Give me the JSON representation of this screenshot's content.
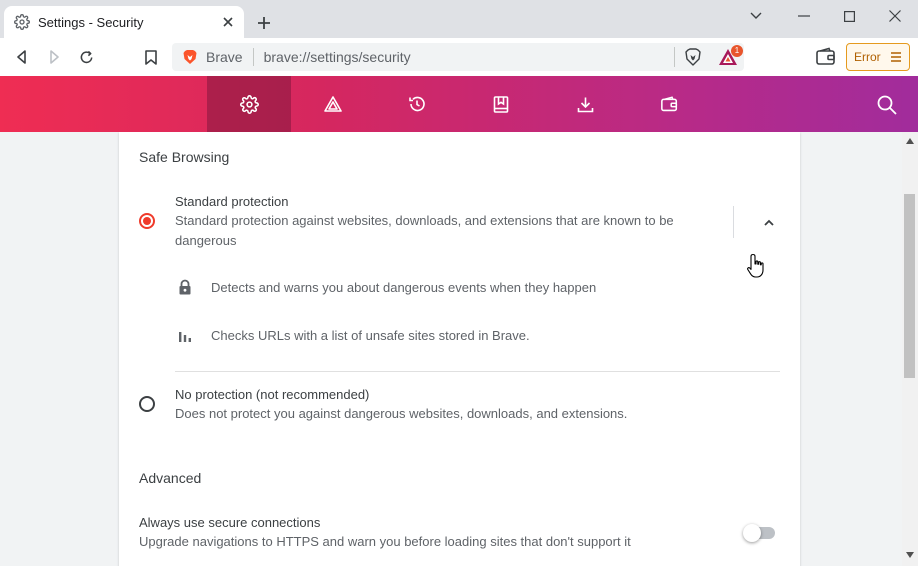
{
  "tab": {
    "title": "Settings - Security",
    "favicon": "gear-icon"
  },
  "window_controls": [
    "chevron-down-icon",
    "minimize-icon",
    "maximize-icon",
    "close-icon"
  ],
  "omnibox": {
    "site_chip": "Brave",
    "url": "brave://settings/security"
  },
  "rewards": {
    "badge": "1"
  },
  "error_button": {
    "label": "Error"
  },
  "nav": {
    "items": [
      "gear-icon",
      "brave-rewards-icon",
      "history-icon",
      "bookmarks-icon",
      "downloads-icon",
      "wallet-icon"
    ],
    "active_index": 0
  },
  "safe_browsing": {
    "heading": "Safe Browsing",
    "standard": {
      "title": "Standard protection",
      "description": "Standard protection against websites, downloads, and extensions that are known to be dangerous",
      "checked": true,
      "details": [
        {
          "icon": "lock-icon",
          "text": "Detects and warns you about dangerous events when they happen"
        },
        {
          "icon": "bar-chart-icon",
          "text": "Checks URLs with a list of unsafe sites stored in Brave."
        }
      ]
    },
    "none": {
      "title": "No protection (not recommended)",
      "description": "Does not protect you against dangerous websites, downloads, and extensions.",
      "checked": false
    }
  },
  "advanced": {
    "heading": "Advanced",
    "secure_connections": {
      "title": "Always use secure connections",
      "description": "Upgrade navigations to HTTPS and warn you before loading sites that don't support it",
      "enabled": false
    }
  },
  "colors": {
    "accent": "#ef3b2b",
    "nav_start": "#ef2d53",
    "nav_end": "#a12c9c",
    "error_border": "#e59a1e"
  }
}
